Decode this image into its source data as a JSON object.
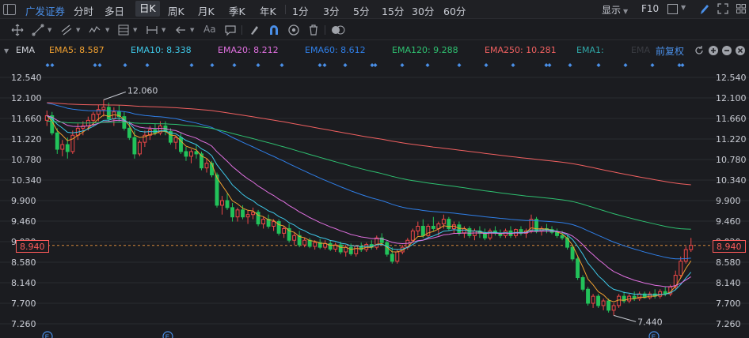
{
  "topbar": {
    "stock_name": "广发证券",
    "periods": [
      "分时",
      "多日",
      "日K",
      "周K",
      "月K",
      "季K",
      "年K",
      "1分",
      "3分",
      "5分",
      "15分",
      "30分",
      "60分"
    ],
    "active_period": "日K",
    "display_label": "显示",
    "f10_label": "F10"
  },
  "toolbar": {
    "text_tool_label": "Aa",
    "icons": [
      "crosshair-icon",
      "line-icon",
      "channel-icon",
      "wave-icon",
      "fib-icon",
      "range-icon",
      "arrow-icon",
      "text-icon",
      "comment-icon",
      "eraser-icon",
      "magnet-icon",
      "eye-icon",
      "trash-icon",
      "toggle-icon"
    ]
  },
  "indicator": {
    "name": "EMA",
    "items": [
      {
        "label": "EMA5: 8.587",
        "color": "#f0a030"
      },
      {
        "label": "EMA10: 8.338",
        "color": "#3ec8e8"
      },
      {
        "label": "EMA20: 8.212",
        "color": "#e070e0"
      },
      {
        "label": "EMA60: 8.612",
        "color": "#2f7fe8"
      },
      {
        "label": "EMA120: 9.288",
        "color": "#2ec070"
      },
      {
        "label": "EMA250: 10.281",
        "color": "#f06060"
      },
      {
        "label": "EMA1:",
        "color": "#2fa8a8"
      },
      {
        "label": "EMA",
        "color": "#3a3c42"
      }
    ],
    "fuquan_label": "前复权"
  },
  "colors": {
    "up": "#f04848",
    "down": "#22c25a",
    "accent": "#4a8fe8",
    "grid": "#2a2c31"
  },
  "chart_data": {
    "type": "candlestick",
    "y_ticks": [
      "12.540",
      "12.100",
      "11.660",
      "11.220",
      "10.780",
      "10.340",
      "9.900",
      "9.460",
      "9.020",
      "8.580",
      "8.140",
      "7.700",
      "7.260"
    ],
    "ylim": [
      7.26,
      12.54
    ],
    "last_price": "8.940",
    "annotations": {
      "high": "12.060",
      "low": "7.440"
    },
    "event_markers": [
      "E",
      "E",
      "E"
    ],
    "n_bars": 220,
    "ohlc": [
      [
        11.62,
        11.83,
        11.5,
        11.72
      ],
      [
        11.72,
        11.8,
        11.3,
        11.35
      ],
      [
        11.35,
        11.45,
        10.9,
        11.0
      ],
      [
        11.0,
        11.2,
        10.85,
        11.1
      ],
      [
        11.1,
        11.25,
        10.8,
        10.95
      ],
      [
        10.95,
        11.4,
        10.9,
        11.3
      ],
      [
        11.3,
        11.55,
        11.2,
        11.45
      ],
      [
        11.45,
        11.6,
        11.3,
        11.5
      ],
      [
        11.5,
        11.7,
        11.4,
        11.62
      ],
      [
        11.62,
        11.8,
        11.5,
        11.75
      ],
      [
        11.75,
        11.95,
        11.6,
        11.85
      ],
      [
        11.85,
        12.06,
        11.7,
        11.9
      ],
      [
        11.9,
        12.0,
        11.6,
        11.65
      ],
      [
        11.65,
        11.9,
        11.5,
        11.8
      ],
      [
        11.8,
        11.95,
        11.6,
        11.7
      ],
      [
        11.7,
        11.8,
        11.4,
        11.45
      ],
      [
        11.45,
        11.6,
        11.2,
        11.25
      ],
      [
        11.25,
        11.4,
        10.8,
        10.9
      ],
      [
        10.9,
        11.2,
        10.85,
        11.15
      ],
      [
        11.15,
        11.4,
        11.05,
        11.3
      ],
      [
        11.3,
        11.5,
        11.2,
        11.42
      ],
      [
        11.42,
        11.55,
        11.3,
        11.35
      ],
      [
        11.35,
        11.6,
        11.3,
        11.5
      ],
      [
        11.5,
        11.6,
        11.3,
        11.38
      ],
      [
        11.38,
        11.45,
        11.1,
        11.15
      ],
      [
        11.15,
        11.3,
        11.0,
        11.25
      ],
      [
        11.25,
        11.35,
        10.9,
        10.95
      ],
      [
        10.95,
        11.05,
        10.75,
        10.85
      ],
      [
        10.85,
        11.0,
        10.7,
        10.95
      ],
      [
        10.95,
        11.1,
        10.8,
        10.9
      ],
      [
        10.9,
        10.95,
        10.55,
        10.6
      ],
      [
        10.6,
        10.8,
        10.5,
        10.7
      ],
      [
        10.7,
        10.75,
        10.4,
        10.45
      ],
      [
        10.45,
        10.5,
        9.75,
        9.8
      ],
      [
        9.8,
        10.0,
        9.6,
        9.9
      ],
      [
        9.9,
        10.05,
        9.7,
        9.75
      ],
      [
        9.75,
        9.85,
        9.45,
        9.55
      ],
      [
        9.55,
        9.75,
        9.45,
        9.7
      ],
      [
        9.7,
        9.8,
        9.5,
        9.55
      ],
      [
        9.55,
        9.7,
        9.4,
        9.6
      ],
      [
        9.6,
        9.75,
        9.5,
        9.65
      ],
      [
        9.65,
        9.7,
        9.35,
        9.4
      ],
      [
        9.4,
        9.55,
        9.3,
        9.5
      ],
      [
        9.5,
        9.6,
        9.3,
        9.35
      ],
      [
        9.35,
        9.5,
        9.25,
        9.45
      ],
      [
        9.45,
        9.5,
        9.15,
        9.2
      ],
      [
        9.2,
        9.35,
        9.1,
        9.3
      ],
      [
        9.3,
        9.4,
        9.0,
        9.05
      ],
      [
        9.05,
        9.2,
        8.95,
        9.15
      ],
      [
        9.15,
        9.25,
        8.9,
        8.95
      ],
      [
        8.95,
        9.1,
        8.9,
        9.05
      ],
      [
        9.05,
        9.1,
        8.88,
        8.92
      ],
      [
        8.92,
        9.05,
        8.85,
        9.0
      ],
      [
        9.0,
        9.08,
        8.86,
        8.9
      ],
      [
        8.9,
        9.05,
        8.85,
        8.98
      ],
      [
        8.98,
        9.05,
        8.82,
        8.86
      ],
      [
        8.86,
        9.0,
        8.8,
        8.95
      ],
      [
        8.95,
        9.02,
        8.75,
        8.8
      ],
      [
        8.8,
        8.95,
        8.7,
        8.9
      ],
      [
        8.9,
        8.98,
        8.72,
        8.76
      ],
      [
        8.76,
        8.95,
        8.7,
        8.92
      ],
      [
        8.92,
        9.0,
        8.8,
        8.85
      ],
      [
        8.85,
        9.0,
        8.8,
        8.96
      ],
      [
        8.96,
        9.05,
        8.85,
        8.9
      ],
      [
        8.9,
        9.15,
        8.85,
        9.1
      ],
      [
        9.1,
        9.2,
        8.95,
        9.0
      ],
      [
        9.0,
        9.05,
        8.7,
        8.75
      ],
      [
        8.75,
        8.9,
        8.55,
        8.6
      ],
      [
        8.6,
        8.85,
        8.55,
        8.8
      ],
      [
        8.8,
        8.95,
        8.75,
        8.9
      ],
      [
        8.9,
        9.1,
        8.85,
        9.05
      ],
      [
        9.05,
        9.3,
        9.0,
        9.25
      ],
      [
        9.25,
        9.45,
        9.15,
        9.35
      ],
      [
        9.35,
        9.5,
        9.1,
        9.15
      ],
      [
        9.15,
        9.4,
        9.1,
        9.35
      ],
      [
        9.35,
        9.55,
        9.25,
        9.3
      ],
      [
        9.3,
        9.45,
        9.15,
        9.4
      ],
      [
        9.4,
        9.6,
        9.3,
        9.5
      ],
      [
        9.5,
        9.55,
        9.25,
        9.3
      ],
      [
        9.3,
        9.45,
        9.2,
        9.38
      ],
      [
        9.38,
        9.45,
        9.15,
        9.2
      ],
      [
        9.2,
        9.35,
        9.1,
        9.3
      ],
      [
        9.3,
        9.35,
        9.1,
        9.15
      ],
      [
        9.15,
        9.3,
        9.05,
        9.25
      ],
      [
        9.25,
        9.35,
        9.1,
        9.2
      ],
      [
        9.2,
        9.3,
        9.05,
        9.1
      ],
      [
        9.1,
        9.3,
        9.05,
        9.25
      ],
      [
        9.25,
        9.35,
        9.15,
        9.2
      ],
      [
        9.2,
        9.28,
        9.1,
        9.15
      ],
      [
        9.15,
        9.3,
        9.1,
        9.25
      ],
      [
        9.25,
        9.35,
        9.1,
        9.15
      ],
      [
        9.15,
        9.3,
        9.1,
        9.28
      ],
      [
        9.28,
        9.35,
        9.15,
        9.2
      ],
      [
        9.2,
        9.3,
        9.1,
        9.25
      ],
      [
        9.25,
        9.6,
        9.2,
        9.5
      ],
      [
        9.5,
        9.55,
        9.2,
        9.25
      ],
      [
        9.25,
        9.35,
        9.15,
        9.3
      ],
      [
        9.3,
        9.4,
        9.2,
        9.28
      ],
      [
        9.28,
        9.35,
        9.18,
        9.22
      ],
      [
        9.22,
        9.3,
        9.1,
        9.15
      ],
      [
        9.15,
        9.25,
        9.05,
        9.1
      ],
      [
        9.1,
        9.15,
        8.85,
        8.9
      ],
      [
        8.9,
        8.95,
        8.6,
        8.65
      ],
      [
        8.65,
        8.7,
        8.2,
        8.25
      ],
      [
        8.25,
        8.3,
        7.95,
        8.0
      ],
      [
        8.0,
        8.05,
        7.65,
        7.7
      ],
      [
        7.7,
        7.9,
        7.6,
        7.85
      ],
      [
        7.85,
        7.9,
        7.6,
        7.65
      ],
      [
        7.65,
        7.8,
        7.55,
        7.75
      ],
      [
        7.75,
        7.8,
        7.5,
        7.55
      ],
      [
        7.55,
        7.7,
        7.44,
        7.65
      ],
      [
        7.65,
        7.9,
        7.6,
        7.85
      ],
      [
        7.85,
        7.95,
        7.7,
        7.75
      ],
      [
        7.75,
        7.9,
        7.7,
        7.85
      ],
      [
        7.85,
        7.95,
        7.75,
        7.8
      ],
      [
        7.8,
        7.95,
        7.75,
        7.9
      ],
      [
        7.9,
        7.95,
        7.8,
        7.82
      ],
      [
        7.82,
        7.95,
        7.78,
        7.9
      ],
      [
        7.9,
        8.0,
        7.8,
        7.85
      ],
      [
        7.85,
        8.0,
        7.8,
        7.95
      ],
      [
        7.95,
        8.05,
        7.85,
        7.9
      ],
      [
        7.9,
        8.1,
        7.85,
        8.05
      ],
      [
        8.05,
        8.4,
        8.0,
        8.3
      ],
      [
        8.3,
        8.7,
        8.25,
        8.6
      ],
      [
        8.6,
        8.92,
        8.55,
        8.85
      ],
      [
        8.85,
        9.1,
        8.8,
        8.94
      ]
    ]
  }
}
